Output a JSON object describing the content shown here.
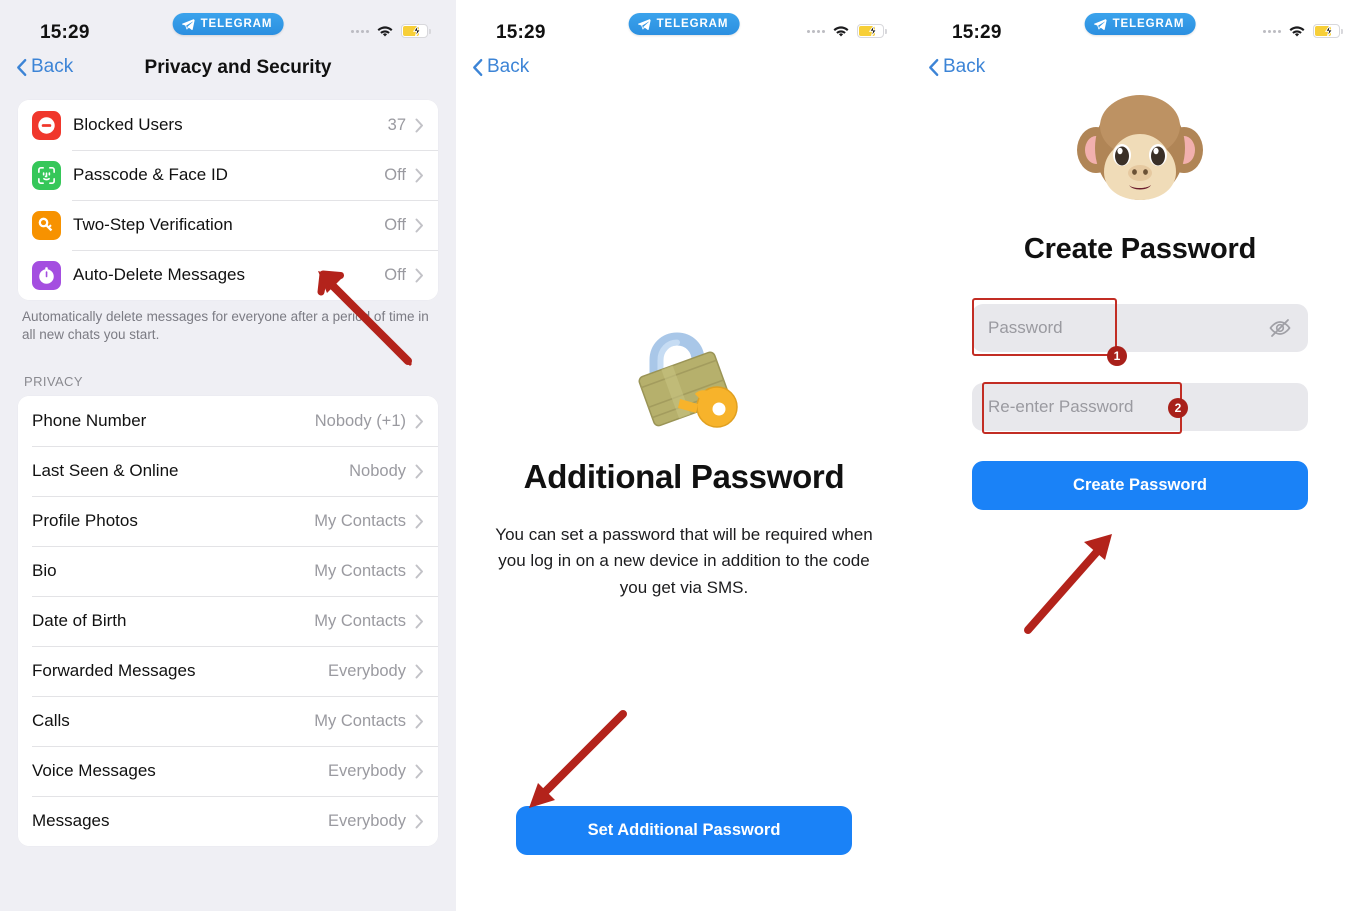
{
  "statusbar": {
    "time": "15:29",
    "app_badge": "TELEGRAM",
    "icons": {
      "plane": "telegram-plane-icon",
      "signal": "signal-dots-icon",
      "wifi": "wifi-icon",
      "battery": "battery-charging-icon"
    }
  },
  "panel1": {
    "nav": {
      "back": "Back",
      "title": "Privacy and Security"
    },
    "security_group": [
      {
        "label": "Blocked Users",
        "value": "37",
        "icon": "blocked-users-icon",
        "color": "#f0372c"
      },
      {
        "label": "Passcode & Face ID",
        "value": "Off",
        "icon": "face-id-icon",
        "color": "#35c759"
      },
      {
        "label": "Two-Step Verification",
        "value": "Off",
        "icon": "key-icon",
        "color": "#f79200"
      },
      {
        "label": "Auto-Delete Messages",
        "value": "Off",
        "icon": "auto-delete-clock-icon",
        "color": "#a košul"
      }
    ],
    "security_group_fix": [
      {
        "label": "Blocked Users",
        "value": "37",
        "icon": "blocked-users-icon",
        "color": "#f0372c"
      },
      {
        "label": "Passcode & Face ID",
        "value": "Off",
        "icon": "face-id-icon",
        "color": "#35c759"
      },
      {
        "label": "Two-Step Verification",
        "value": "Off",
        "icon": "key-icon",
        "color": "#f79200"
      },
      {
        "label": "Auto-Delete Messages",
        "value": "Off",
        "icon": "auto-delete-clock-icon",
        "color": "#a44ee0"
      }
    ],
    "group_footer": "Automatically delete messages for everyone after a period of time in all new chats you start.",
    "section_header": "PRIVACY",
    "privacy_group": [
      {
        "label": "Phone Number",
        "value": "Nobody (+1)"
      },
      {
        "label": "Last Seen & Online",
        "value": "Nobody"
      },
      {
        "label": "Profile Photos",
        "value": "My Contacts"
      },
      {
        "label": "Bio",
        "value": "My Contacts"
      },
      {
        "label": "Date of Birth",
        "value": "My Contacts"
      },
      {
        "label": "Forwarded Messages",
        "value": "Everybody"
      },
      {
        "label": "Calls",
        "value": "My Contacts"
      },
      {
        "label": "Voice Messages",
        "value": "Everybody"
      },
      {
        "label": "Messages",
        "value": "Everybody"
      }
    ]
  },
  "panel2": {
    "nav": {
      "back": "Back"
    },
    "hero_icon": "locked-with-key-emoji",
    "title": "Additional Password",
    "description": "You can set a password that will be required when you log in on a new device in addition to the code you get via SMS.",
    "button": "Set Additional Password"
  },
  "panel3": {
    "nav": {
      "back": "Back"
    },
    "hero_icon": "monkey-face-emoji",
    "title": "Create Password",
    "fields": [
      {
        "placeholder": "Password",
        "value": "",
        "trailing_icon": "eye-slash-icon",
        "badge": "1"
      },
      {
        "placeholder": "Re-enter Password",
        "value": "",
        "badge": "2"
      }
    ],
    "button": "Create Password"
  },
  "colors": {
    "accent_blue": "#1a82f7",
    "link_blue": "#3c84d6",
    "annotation_red": "#c22d24",
    "badge_red": "#a8201a",
    "page_gray": "#efeff4",
    "field_gray": "#e8e8ec"
  }
}
